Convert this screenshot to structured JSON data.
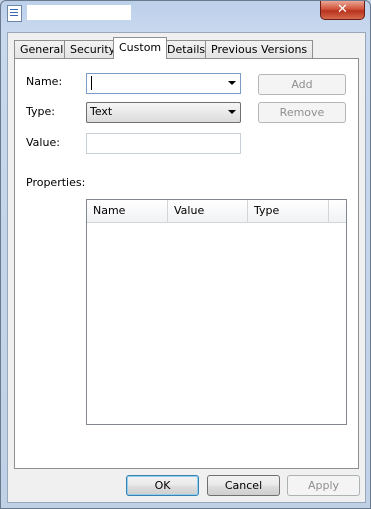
{
  "window": {
    "title": "",
    "close_glyph": "✕"
  },
  "tabs": [
    {
      "label": "General"
    },
    {
      "label": "Security"
    },
    {
      "label": "Custom"
    },
    {
      "label": "Details"
    },
    {
      "label": "Previous Versions"
    }
  ],
  "custom": {
    "name_label": "Name:",
    "name_value": "",
    "type_label": "Type:",
    "type_value": "Text",
    "value_label": "Value:",
    "value_value": "",
    "add_label": "Add",
    "remove_label": "Remove",
    "properties_label": "Properties:",
    "columns": [
      "Name",
      "Value",
      "Type"
    ]
  },
  "buttons": {
    "ok": "OK",
    "cancel": "Cancel",
    "apply": "Apply"
  }
}
